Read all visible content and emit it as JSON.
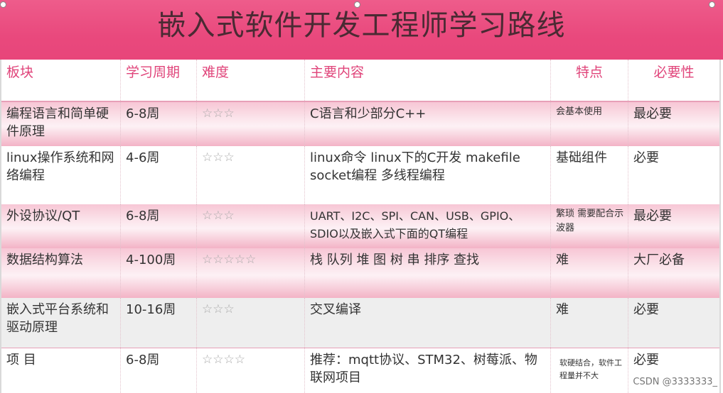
{
  "title": "嵌入式软件开发工程师学习路线",
  "headers": {
    "module": "板块",
    "period": "学习周期",
    "difficulty": "难度",
    "content": "主要内容",
    "feature": "特点",
    "necessity": "必要性"
  },
  "rows": [
    {
      "module": "编程语言和简单硬件原理",
      "period": "6-8周",
      "difficulty": "☆☆☆",
      "content": "C语言和少部分C++",
      "feature": "会基本使用",
      "necessity": "最必要"
    },
    {
      "module": "linux操作系统和网络编程",
      "period": "4-6周",
      "difficulty": "☆☆☆",
      "content": "linux命令 linux下的C开发 makefile socket编程 多线程编程",
      "feature": "基础组件",
      "necessity": "必要"
    },
    {
      "module": "外设协议/QT",
      "period": "6-8周",
      "difficulty": "☆☆☆",
      "content": "UART、I2C、SPI、CAN、USB、GPIO、SDIO以及嵌入式下面的QT编程",
      "feature": "繁琐 需要配合示波器",
      "necessity": "最必要"
    },
    {
      "module": "数据结构算法",
      "period": "4-100周",
      "difficulty": "☆☆☆☆☆",
      "content": "栈 队列 堆 图 树 串 排序 查找",
      "feature": "难",
      "necessity": "大厂必备"
    },
    {
      "module": "嵌入式平台系统和驱动原理",
      "period": "10-16周",
      "difficulty": "☆☆☆",
      "content": "交叉编译",
      "feature": "难",
      "necessity": "必要"
    },
    {
      "module": "项 目",
      "period": "6-8周",
      "difficulty": "☆☆☆☆",
      "content": "推荐：mqtt协议、STM32、树莓派、物联网项目",
      "feature": "软硬结合，软件工程量并不大",
      "necessity": "必要"
    }
  ],
  "watermark": "CSDN @3333333_"
}
